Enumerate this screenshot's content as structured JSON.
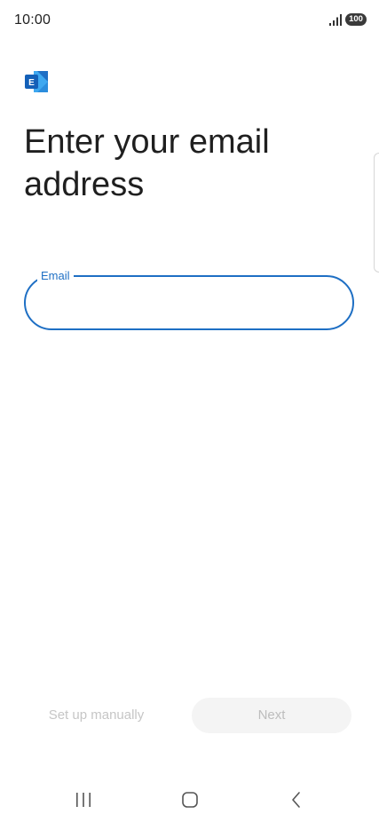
{
  "status_bar": {
    "time": "10:00",
    "battery": "100",
    "icons": [
      "signal-icon",
      "battery-icon"
    ]
  },
  "app": {
    "logo_icon": "exchange-logo-icon",
    "logo_letter": "E",
    "colors": {
      "logo_dark": "#1f6fc5",
      "logo_light": "#3ea8f0",
      "accent": "#1e6fc4"
    }
  },
  "page": {
    "title": "Enter your email address"
  },
  "email_field": {
    "label": "Email",
    "value": ""
  },
  "actions": {
    "setup_manually_label": "Set up manually",
    "next_label": "Next"
  },
  "nav_bar": {
    "icons": [
      "recents-icon",
      "home-icon",
      "back-icon"
    ]
  }
}
